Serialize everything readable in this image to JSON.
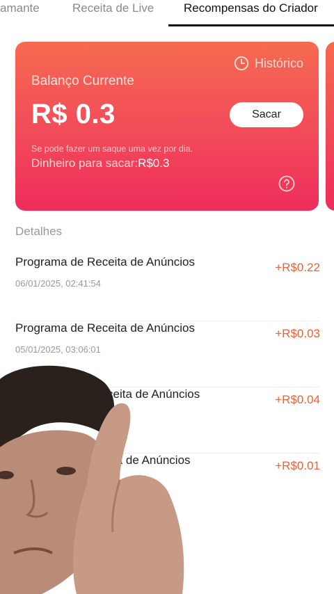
{
  "tabs": [
    {
      "label": "amante"
    },
    {
      "label": "Receita de Live"
    },
    {
      "label": "Recompensas do Criador"
    }
  ],
  "card": {
    "history_label": "Histórico",
    "balance_label": "Balanço Currente",
    "balance_value": "R$ 0.3",
    "withdraw_label": "Sacar",
    "note": "Se pode fazer um saque uma vez por dia.",
    "available_label": "Dinheiro para sacar:",
    "available_value": "R$0.3"
  },
  "details": {
    "title": "Detalhes",
    "items": [
      {
        "title": "Programa de Receita de Anúncios",
        "date": "06/01/2025, 02:41:54",
        "amount": "+R$0.22"
      },
      {
        "title": "Programa de Receita de Anúncios",
        "date": "05/01/2025, 03:06:01",
        "amount": "+R$0.03"
      },
      {
        "title": "ceita de Anúncios",
        "date": "",
        "amount": "+R$0.04"
      },
      {
        "title": "ta de Anúncios",
        "date": "",
        "amount": "+R$0.01"
      }
    ]
  },
  "colors": {
    "card_top": "#f56a50",
    "card_bottom": "#ee2d5b",
    "amount": "#e8623a"
  }
}
